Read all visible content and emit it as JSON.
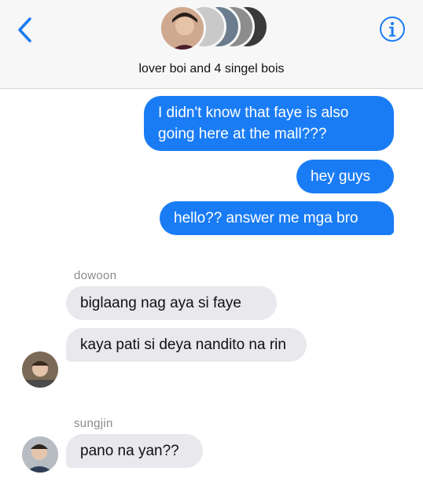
{
  "header": {
    "title": "lover boi and 4 singel bois"
  },
  "messages": [
    {
      "direction": "outgoing",
      "text": "I didn't know that faye is also going here at the mall???"
    },
    {
      "direction": "outgoing",
      "text": "hey guys"
    },
    {
      "direction": "outgoing",
      "text": "hello?? answer me mga bro"
    },
    {
      "direction": "incoming",
      "sender": "dowoon",
      "text": "biglaang nag aya si faye"
    },
    {
      "direction": "incoming",
      "text": "kaya pati si deya nandito na rin"
    },
    {
      "direction": "incoming",
      "sender": "sungjin",
      "text": "pano na yan??"
    }
  ],
  "colors": {
    "outgoing_bubble": "#1a7cf5",
    "incoming_bubble": "#e8e8ed",
    "accent": "#1a7cf5"
  },
  "icons": {
    "back": "chevron-left-icon",
    "info": "info-circle-icon"
  }
}
